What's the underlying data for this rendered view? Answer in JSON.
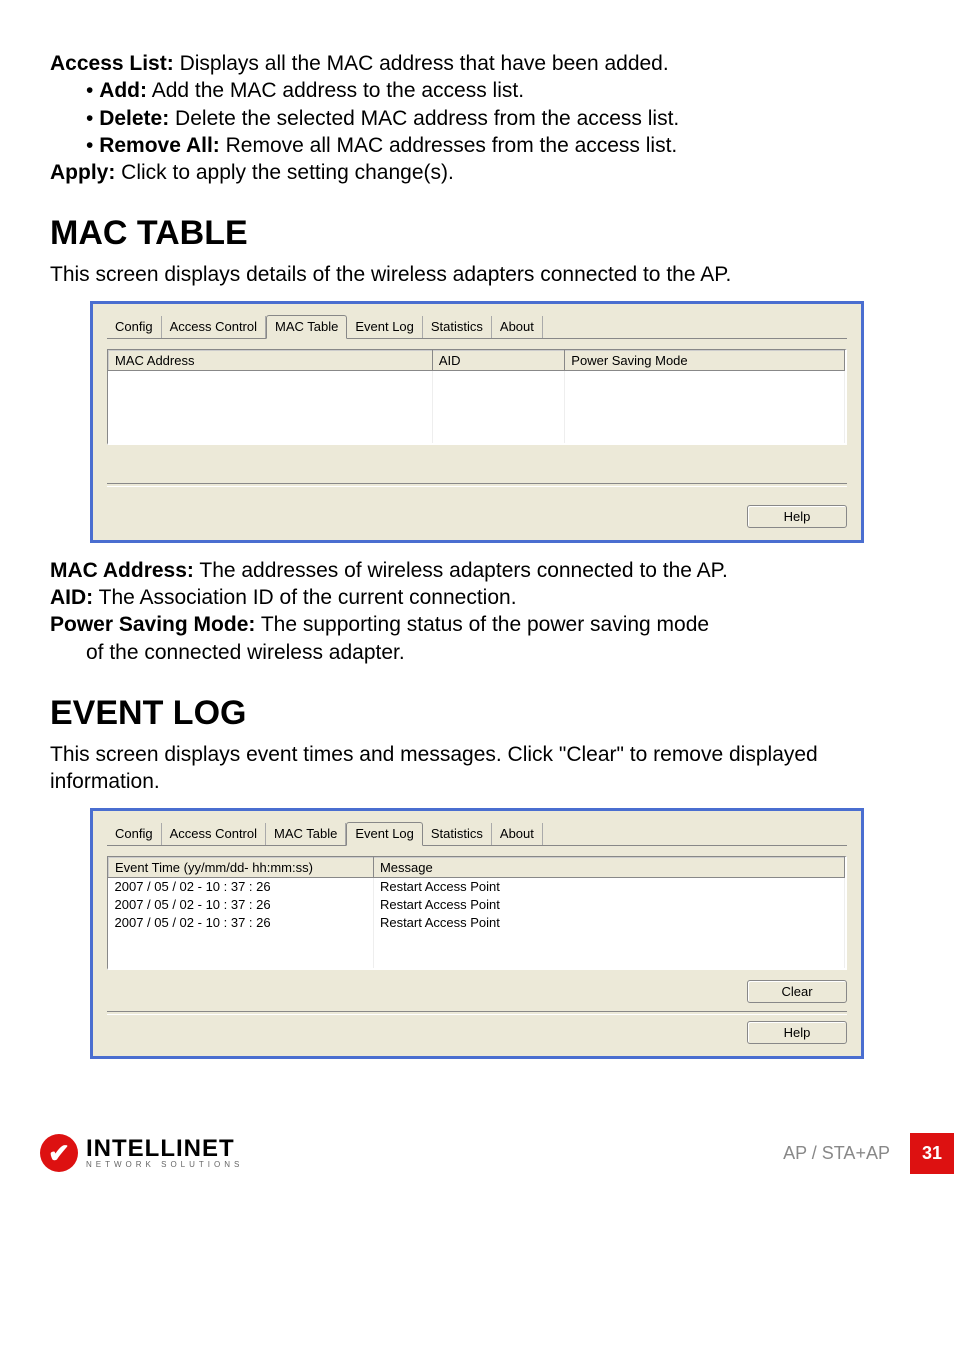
{
  "intro": {
    "access_list_label": "Access List:",
    "access_list_text": " Displays all the MAC address that have been added.",
    "add_label": "Add:",
    "add_text": " Add the MAC address to the access list.",
    "delete_label": "Delete:",
    "delete_text": " Delete the selected MAC address from the access list.",
    "remove_all_label": "Remove All:",
    "remove_all_text": " Remove all MAC addresses from the access list.",
    "apply_label": "Apply:",
    "apply_text": " Click to apply the setting change(s)."
  },
  "mac_table": {
    "heading": "MAC TABLE",
    "desc": "This screen displays details of the wireless adapters connected to the AP.",
    "tabs": [
      "Config",
      "Access Control",
      "MAC Table",
      "Event Log",
      "Statistics",
      "About"
    ],
    "active_tab": "MAC Table",
    "columns": [
      "MAC Address",
      "AID",
      "Power Saving Mode"
    ],
    "help": "Help",
    "desc_mac_label": "MAC Address:",
    "desc_mac_text": " The addresses of wireless adapters connected to the AP.",
    "desc_aid_label": "AID:",
    "desc_aid_text": " The Association ID of the current connection.",
    "desc_psm_label": "Power Saving Mode:",
    "desc_psm_text1": " The supporting status of the power saving mode",
    "desc_psm_text2": "of the connected wireless adapter."
  },
  "event_log": {
    "heading": "EVENT LOG",
    "desc": "This screen displays event times and messages. Click \"Clear\" to remove displayed information.",
    "tabs": [
      "Config",
      "Access Control",
      "MAC Table",
      "Event Log",
      "Statistics",
      "About"
    ],
    "active_tab": "Event Log",
    "columns": [
      "Event Time (yy/mm/dd- hh:mm:ss)",
      "Message"
    ],
    "rows": [
      {
        "time": "2007 / 05 / 02 - 10 : 37 : 26",
        "msg": "Restart Access Point"
      },
      {
        "time": "2007 / 05 / 02 - 10 : 37 : 26",
        "msg": "Restart Access Point"
      },
      {
        "time": "2007 / 05 / 02 - 10 : 37 : 26",
        "msg": "Restart Access Point"
      }
    ],
    "clear": "Clear",
    "help": "Help"
  },
  "footer": {
    "brand_big": "INTELLINET",
    "brand_small": "NETWORK SOLUTIONS",
    "section": "AP / STA+AP",
    "page": "31"
  }
}
